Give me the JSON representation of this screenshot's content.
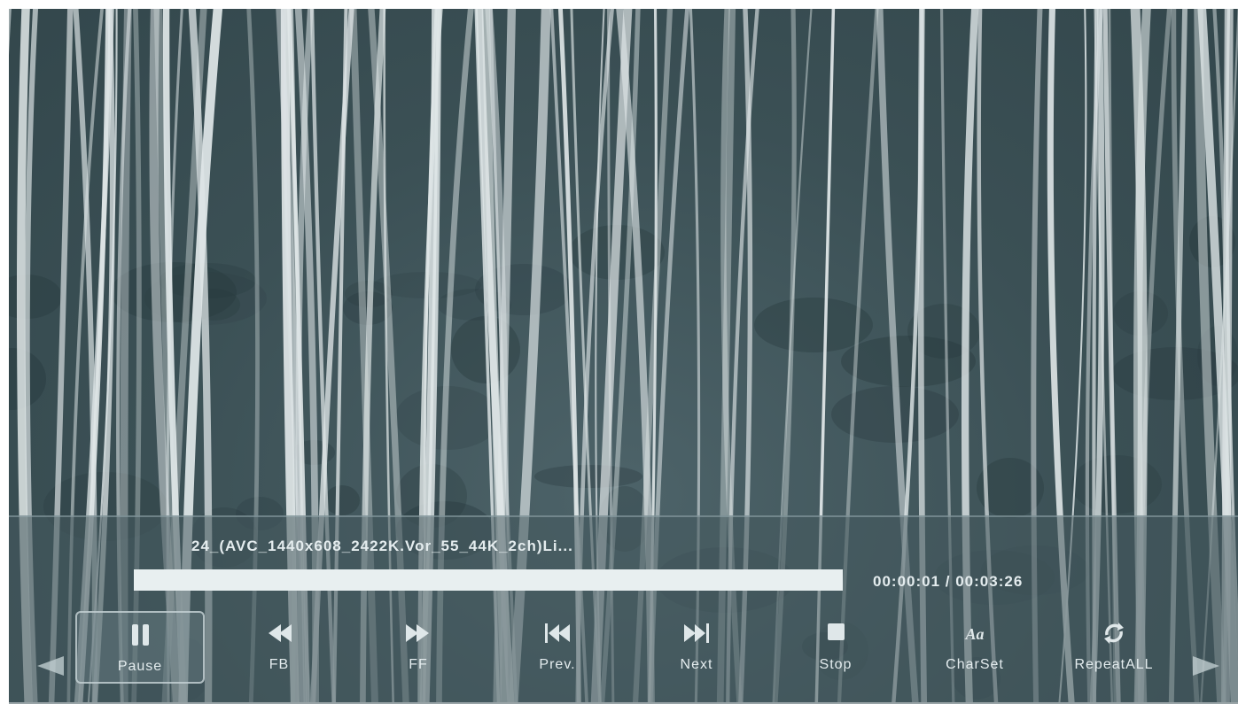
{
  "player": {
    "filename": "24_(AVC_1440x608_2422K.Vor_55_44K_2ch)Li...",
    "time": "00:00:01 / 00:03:26",
    "progress_fraction": 1.0
  },
  "controls": [
    {
      "name": "pause-button",
      "icon": "pause-icon",
      "label": "Pause",
      "selected": true
    },
    {
      "name": "fb-button",
      "icon": "fast-backward-icon",
      "label": "FB",
      "selected": false
    },
    {
      "name": "ff-button",
      "icon": "fast-forward-icon",
      "label": "FF",
      "selected": false
    },
    {
      "name": "prev-button",
      "icon": "previous-track-icon",
      "label": "Prev.",
      "selected": false
    },
    {
      "name": "next-button",
      "icon": "next-track-icon",
      "label": "Next",
      "selected": false
    },
    {
      "name": "stop-button",
      "icon": "stop-icon",
      "label": "Stop",
      "selected": false
    },
    {
      "name": "charset-button",
      "icon": "charset-icon",
      "label": "CharSet",
      "selected": false
    },
    {
      "name": "repeat-button",
      "icon": "repeat-icon",
      "label": "RepeatALL",
      "selected": false
    }
  ],
  "charset_glyph": "Aa",
  "colors": {
    "osd_text": "#e4ecee",
    "icon": "#dfe7e9"
  }
}
